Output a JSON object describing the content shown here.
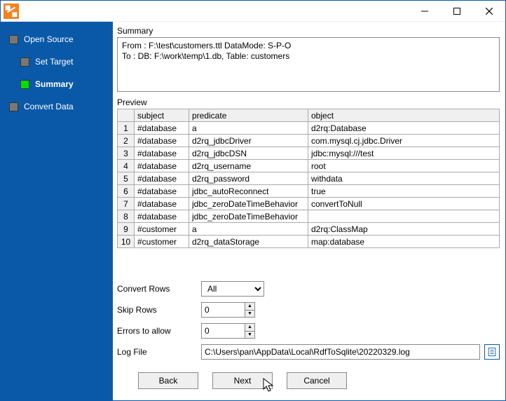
{
  "sidebar": {
    "items": [
      {
        "label": "Open Source",
        "active": false
      },
      {
        "label": "Set Target",
        "active": false
      },
      {
        "label": "Summary",
        "active": true
      },
      {
        "label": "Convert Data",
        "active": false
      }
    ]
  },
  "summary": {
    "title": "Summary",
    "text": "From : F:\\test\\customers.ttl DataMode: S-P-O\nTo : DB: F:\\work\\temp\\1.db, Table: customers"
  },
  "preview": {
    "title": "Preview",
    "columns": [
      "subject",
      "predicate",
      "object"
    ],
    "rows": [
      [
        "#database",
        "a",
        "d2rq:Database"
      ],
      [
        "#database",
        "d2rq_jdbcDriver",
        "com.mysql.cj.jdbc.Driver"
      ],
      [
        "#database",
        "d2rq_jdbcDSN",
        "jdbc:mysql:///test"
      ],
      [
        "#database",
        "d2rq_username",
        "root"
      ],
      [
        "#database",
        "d2rq_password",
        "withdata"
      ],
      [
        "#database",
        "jdbc_autoReconnect",
        "true"
      ],
      [
        "#database",
        "jdbc_zeroDateTimeBehavior",
        "convertToNull"
      ],
      [
        "#database",
        "jdbc_zeroDateTimeBehavior",
        ""
      ],
      [
        "#customer",
        "a",
        "d2rq:ClassMap"
      ],
      [
        "#customer",
        "d2rq_dataStorage",
        "map:database"
      ]
    ]
  },
  "options": {
    "convert_rows_label": "Convert Rows",
    "convert_rows_value": "All",
    "skip_rows_label": "Skip Rows",
    "skip_rows_value": "0",
    "errors_label": "Errors to allow",
    "errors_value": "0",
    "log_label": "Log File",
    "log_value": "C:\\Users\\pan\\AppData\\Local\\RdfToSqlite\\20220329.log"
  },
  "footer": {
    "back": "Back",
    "next": "Next",
    "cancel": "Cancel"
  }
}
